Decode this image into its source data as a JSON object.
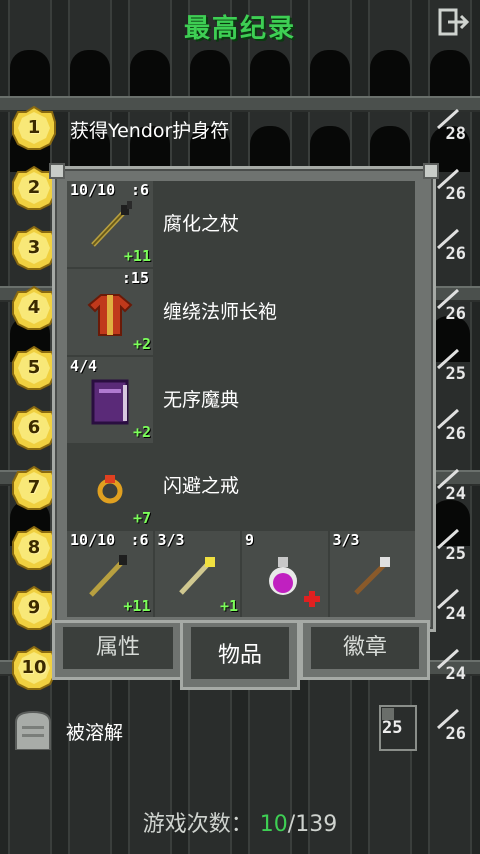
{
  "header": {
    "title": "最高纪录",
    "exit_icon": "exit-door-icon"
  },
  "rankings": [
    {
      "rank": "1",
      "text": "获得Yendor护身符",
      "level": "28"
    },
    {
      "rank": "2",
      "text": "",
      "level": "26"
    },
    {
      "rank": "3",
      "text": "",
      "level": "26"
    },
    {
      "rank": "4",
      "text": "",
      "level": "26"
    },
    {
      "rank": "5",
      "text": "",
      "level": "25"
    },
    {
      "rank": "6",
      "text": "",
      "level": "26"
    },
    {
      "rank": "7",
      "text": "",
      "level": "24"
    },
    {
      "rank": "8",
      "text": "",
      "level": "25"
    },
    {
      "rank": "9",
      "text": "",
      "level": "24"
    },
    {
      "rank": "10",
      "text": "",
      "level": "24"
    }
  ],
  "items": [
    {
      "name": "腐化之杖",
      "top_left": "10/10",
      "top_right": ":6",
      "bonus": "+11",
      "icon": "staff-icon"
    },
    {
      "name": "缠绕法师长袍",
      "top_left": "",
      "top_right": ":15",
      "bonus": "+2",
      "icon": "robe-icon"
    },
    {
      "name": "无序魔典",
      "top_left": "4/4",
      "top_right": "",
      "bonus": "+2",
      "icon": "spellbook-icon"
    },
    {
      "name": "闪避之戒",
      "top_left": "",
      "top_right": "",
      "bonus": "+7",
      "icon": "ring-icon"
    }
  ],
  "quickslots": [
    {
      "top_left": "10/10",
      "top_right": ":6",
      "bonus": "+11",
      "icon": "staff-icon"
    },
    {
      "top_left": "3/3",
      "top_right": "",
      "bonus": "+1",
      "icon": "wand-icon"
    },
    {
      "top_left": "9",
      "top_right": "",
      "bonus": "",
      "icon": "potion-icon"
    },
    {
      "top_left": "3/3",
      "top_right": "",
      "bonus": "",
      "icon": "wand-icon"
    }
  ],
  "tabs": {
    "stats": "属性",
    "items": "物品",
    "badges": "徽章"
  },
  "bottom": {
    "label": "被溶解",
    "depth": "25",
    "level": "26"
  },
  "footer": {
    "prefix": "游戏次数：",
    "played": "10",
    "total": "/139"
  },
  "colors": {
    "title": "#3ecf54",
    "bonus": "#7cff5a"
  }
}
